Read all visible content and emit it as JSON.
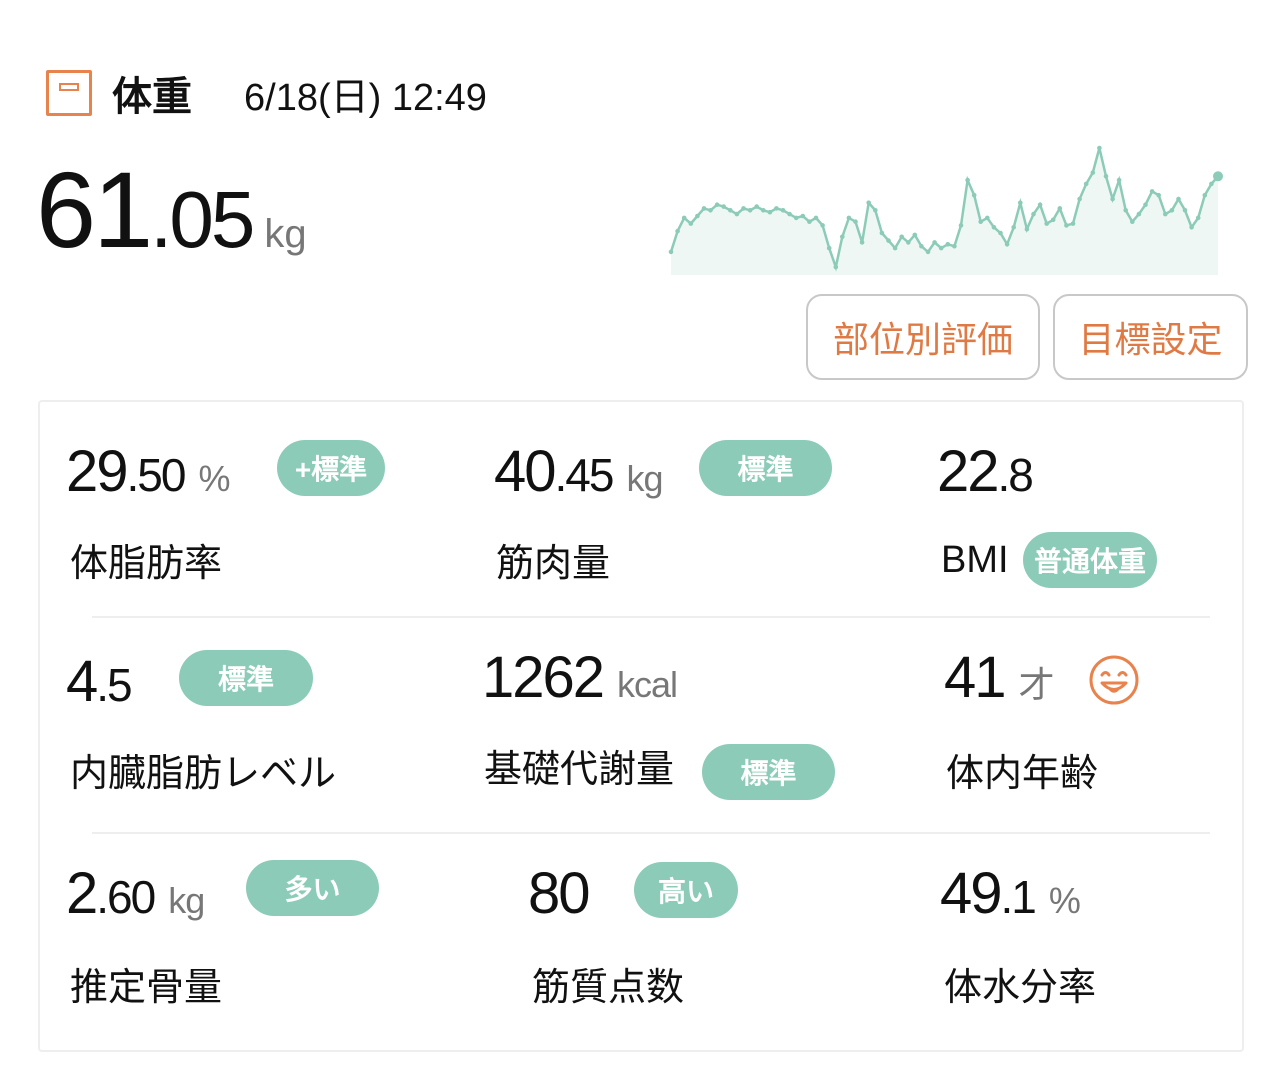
{
  "header": {
    "icon": "scale-icon",
    "title": "体重",
    "datetime": "6/18(日) 12:49"
  },
  "weight": {
    "int": "61",
    "dec": ".05",
    "unit": "kg"
  },
  "trend": {
    "line_color": "#8ccbb7",
    "fill_color": "#eef7f4",
    "values": [
      61.0,
      62.1,
      62.8,
      62.5,
      62.9,
      63.3,
      63.2,
      63.5,
      63.4,
      63.2,
      63.0,
      63.3,
      63.2,
      63.4,
      63.2,
      63.1,
      63.3,
      63.2,
      63.0,
      62.8,
      62.9,
      62.6,
      62.8,
      62.4,
      61.2,
      60.2,
      61.8,
      62.8,
      62.6,
      61.5,
      63.6,
      63.2,
      62.0,
      61.6,
      61.2,
      61.8,
      61.5,
      61.9,
      61.3,
      61.0,
      61.5,
      61.2,
      61.4,
      61.3,
      62.4,
      64.8,
      64.0,
      62.6,
      62.8,
      62.3,
      62.0,
      61.4,
      62.3,
      63.6,
      62.2,
      63.0,
      63.5,
      62.5,
      62.7,
      63.3,
      62.4,
      62.5,
      63.8,
      64.6,
      65.2,
      66.5,
      65.0,
      63.8,
      64.8,
      63.2,
      62.6,
      63.0,
      63.5,
      64.2,
      64.0,
      63.0,
      63.2,
      63.8,
      63.2,
      62.3,
      62.8,
      64.0,
      64.6,
      65.0
    ]
  },
  "buttons": {
    "body_parts": "部位別評価",
    "goal": "目標設定"
  },
  "metrics": {
    "body_fat": {
      "int": "29",
      "dec": ".50",
      "unit": "%",
      "badge": "+標準",
      "label": "体脂肪率"
    },
    "muscle": {
      "int": "40",
      "dec": ".45",
      "unit": "kg",
      "badge": "標準",
      "label": "筋肉量"
    },
    "bmi": {
      "int": "22",
      "dec": ".8",
      "label": "BMI",
      "badge": "普通体重"
    },
    "visceral": {
      "int": "4",
      "dec": ".5",
      "badge": "標準",
      "label": "内臓脂肪レベル"
    },
    "bmr": {
      "int": "1262",
      "unit": "kcal",
      "label": "基礎代謝量",
      "badge": "標準"
    },
    "body_age": {
      "int": "41",
      "unit": "才",
      "icon": "smiling-face-icon",
      "label": "体内年齢"
    },
    "bone": {
      "int": "2",
      "dec": ".60",
      "unit": "kg",
      "badge": "多い",
      "label": "推定骨量"
    },
    "muscle_score": {
      "int": "80",
      "badge": "高い",
      "label": "筋質点数"
    },
    "water": {
      "int": "49",
      "dec": ".1",
      "unit": "%",
      "label": "体水分率"
    }
  },
  "colors": {
    "accent_orange": "#e8834e",
    "badge_green": "#8ccbb7"
  }
}
